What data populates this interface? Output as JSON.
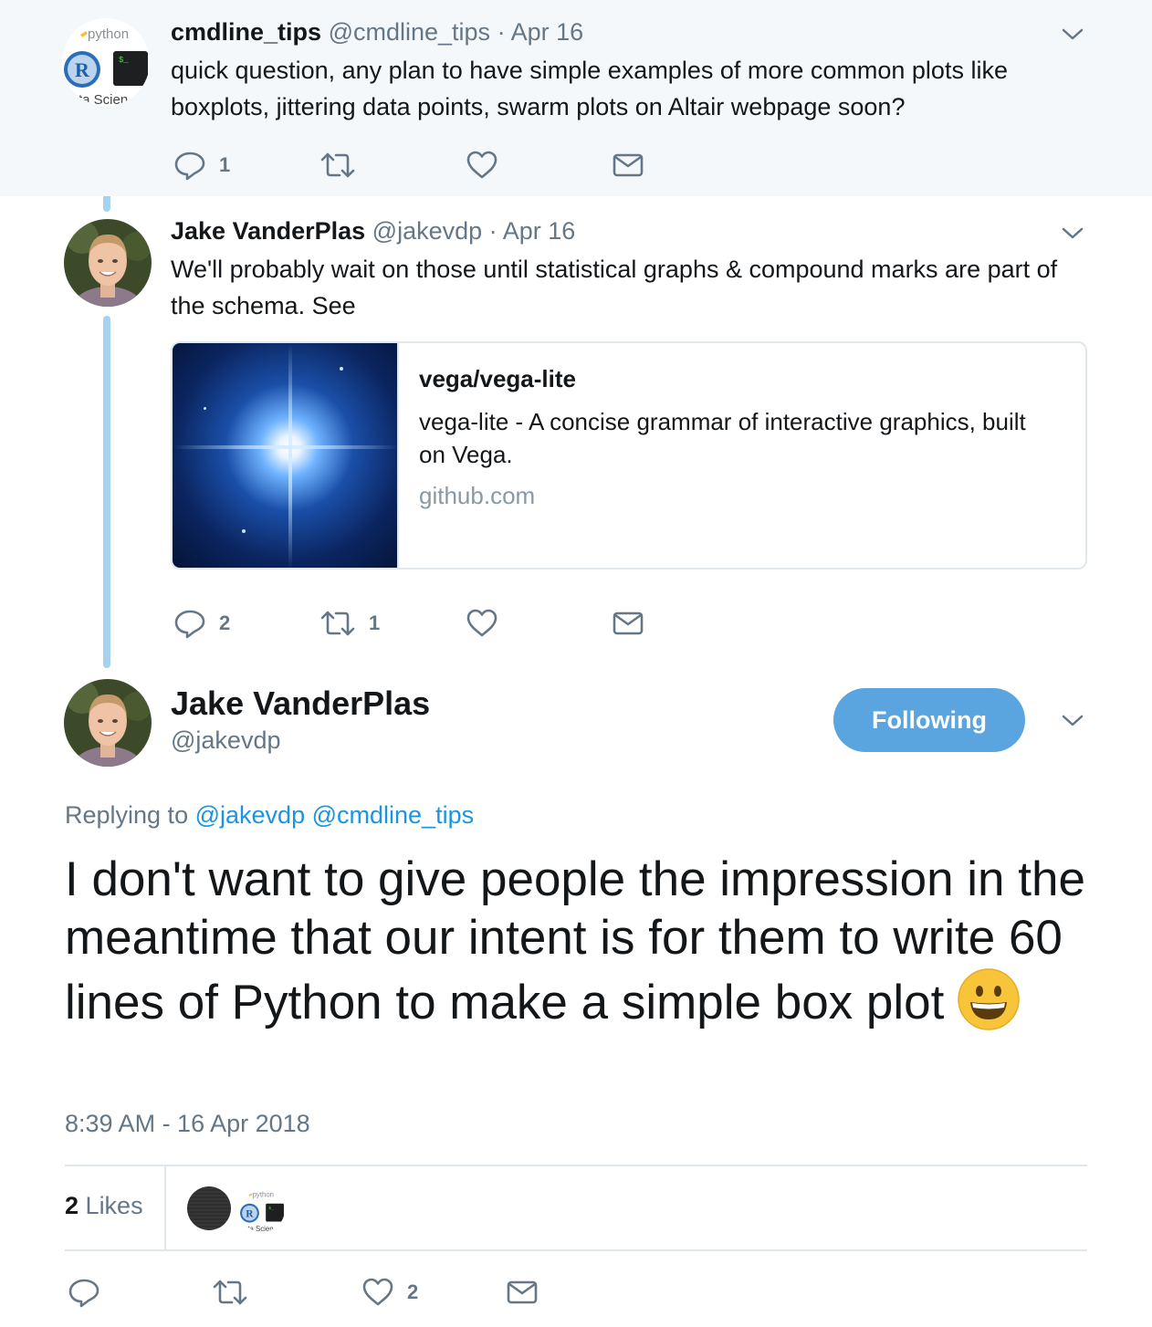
{
  "tweets": [
    {
      "name": "cmdline_tips",
      "handle": "@cmdline_tips",
      "date": "Apr 16",
      "text": "quick question, any plan to have simple examples of more common plots  like boxplots, jittering data points, swarm plots on Altair webpage soon?",
      "avatar_text": {
        "python": "python",
        "r": "R",
        "terminal": "$_",
        "caption": "ta Scien"
      },
      "actions": {
        "reply_count": "1",
        "retweet_count": "",
        "like_count": ""
      }
    },
    {
      "name": "Jake VanderPlas",
      "handle": "@jakevdp",
      "date": "Apr 16",
      "text": "We'll probably wait on those until statistical graphs & compound marks are part of the schema. See",
      "card": {
        "title": "vega/vega-lite",
        "description": "vega-lite - A concise grammar of interactive graphics, built on Vega.",
        "domain": "github.com"
      },
      "actions": {
        "reply_count": "2",
        "retweet_count": "1",
        "like_count": ""
      }
    }
  ],
  "main_tweet": {
    "name": "Jake VanderPlas",
    "handle": "@jakevdp",
    "follow_label": "Following",
    "replying_prefix": "Replying to",
    "replying_mentions": [
      "@jakevdp",
      "@cmdline_tips"
    ],
    "text": "I don't want to give people the impression in the meantime that our intent is for them to write 60 lines of Python to make a simple box plot",
    "timestamp": "8:39 AM - 16 Apr 2018",
    "likes": {
      "count": "2",
      "label": "Likes"
    },
    "actions": {
      "reply_count": "",
      "retweet_count": "",
      "like_count": "2"
    }
  },
  "colors": {
    "thread_line": "#a5d2f1",
    "highlight_bg": "#f5f8fa",
    "follow_button": "#5aa5e0",
    "mention": "#1b95e0",
    "muted": "#657786"
  },
  "icons": [
    "reply-icon",
    "retweet-icon",
    "like-icon",
    "dm-icon",
    "chevron-down-icon",
    "grinning-emoji-icon"
  ]
}
